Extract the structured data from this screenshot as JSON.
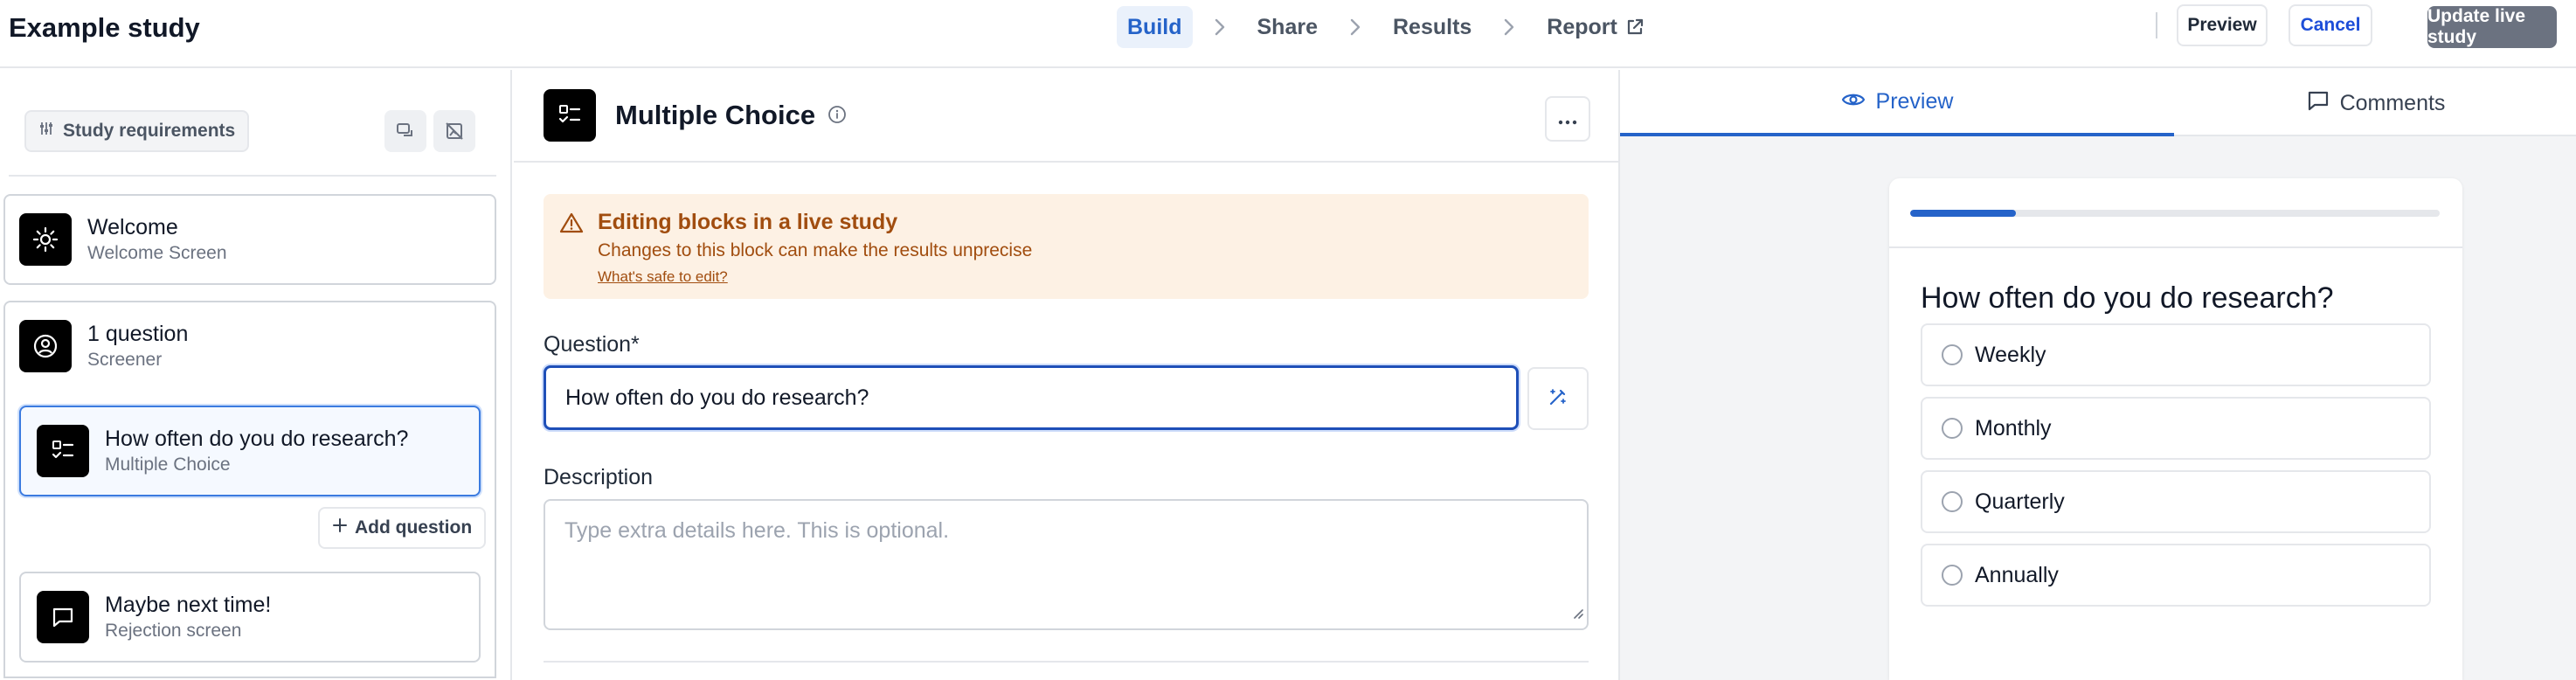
{
  "header": {
    "title": "Example study",
    "steps": [
      {
        "label": "Build"
      },
      {
        "label": "Share"
      },
      {
        "label": "Results"
      },
      {
        "label": "Report"
      }
    ],
    "preview_label": "Preview",
    "cancel_label": "Cancel",
    "update_label": "Update live study"
  },
  "sidebar": {
    "requirements_label": "Study requirements",
    "welcome": {
      "title": "Welcome",
      "subtitle": "Welcome Screen",
      "icon": "sun-icon"
    },
    "screener": {
      "title": "1 question",
      "subtitle": "Screener",
      "icon": "user-circle-icon"
    },
    "question": {
      "title": "How often do you do research?",
      "subtitle": "Multiple Choice",
      "icon": "checklist-icon"
    },
    "add_question_label": "Add question",
    "rejection": {
      "title": "Maybe next time!",
      "subtitle": "Rejection screen",
      "icon": "message-square-icon"
    }
  },
  "editor": {
    "block_title": "Multiple Choice",
    "alert": {
      "title": "Editing blocks in a live study",
      "text": "Changes to this block can make the results unprecise",
      "link": "What's safe to edit?"
    },
    "question_label": "Question*",
    "question_value": "How often do you do research?",
    "description_label": "Description",
    "description_placeholder": "Type extra details here. This is optional."
  },
  "preview_panel": {
    "tabs": {
      "preview": "Preview",
      "comments": "Comments"
    },
    "progress": 0.2,
    "question": "How often do you do research?",
    "options": [
      "Weekly",
      "Monthly",
      "Quarterly",
      "Annually"
    ]
  },
  "colors": {
    "accent": "#2563c9",
    "focus_border": "#1e4fb8",
    "warning_bg": "#fdf1e4",
    "warning_text": "#a14d0f",
    "update_button": "#6b7280"
  }
}
